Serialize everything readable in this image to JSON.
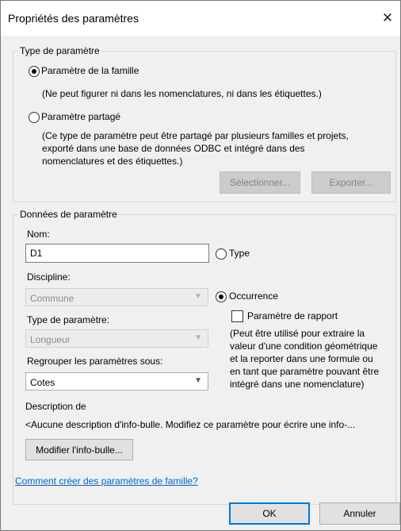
{
  "window": {
    "title": "Propriétés des paramètres",
    "close_glyph": "✕"
  },
  "param_type": {
    "legend": "Type de paramètre",
    "family_label": "Paramètre de la famille",
    "family_note": "(Ne peut figurer ni dans les nomenclatures, ni dans les étiquettes.)",
    "shared_label": "Paramètre partagé",
    "shared_note_lines": [
      "(Ce type de paramètre peut être partagé par plusieurs familles et projets,",
      "exporté dans une base de données ODBC et intégré dans des",
      "nomenclatures et des étiquettes.)"
    ],
    "select_button": "Sélectionner...",
    "export_button": "Exporter...",
    "selected": "family"
  },
  "param_data": {
    "legend": "Données de paramètre",
    "name_label": "Nom:",
    "name_value": "D1",
    "type_radio": "Type",
    "discipline_label": "Discipline:",
    "discipline_value": "Commune",
    "occurrence_radio": "Occurrence",
    "report_param_label": "Paramètre de rapport",
    "report_note_lines": [
      "(Peut être utilisé pour extraire la",
      "valeur d'une condition géométrique",
      "et la reporter dans une formule ou",
      "en tant que paramètre pouvant être",
      "intégré dans une nomenclature)"
    ],
    "param_type_label": "Type de paramètre:",
    "param_type_value": "Longueur",
    "group_label": "Regrouper les paramètres sous:",
    "group_value": "Cotes",
    "description_label": "Description de",
    "description_text": "<Aucune description d'info-bulle. Modifiez ce paramètre pour écrire une info-...",
    "edit_tooltip_button": "Modifier l'info-bulle...",
    "selected": "occurrence"
  },
  "help_link": "Comment créer des paramètres de famille?",
  "footer": {
    "ok": "OK",
    "cancel": "Annuler"
  }
}
